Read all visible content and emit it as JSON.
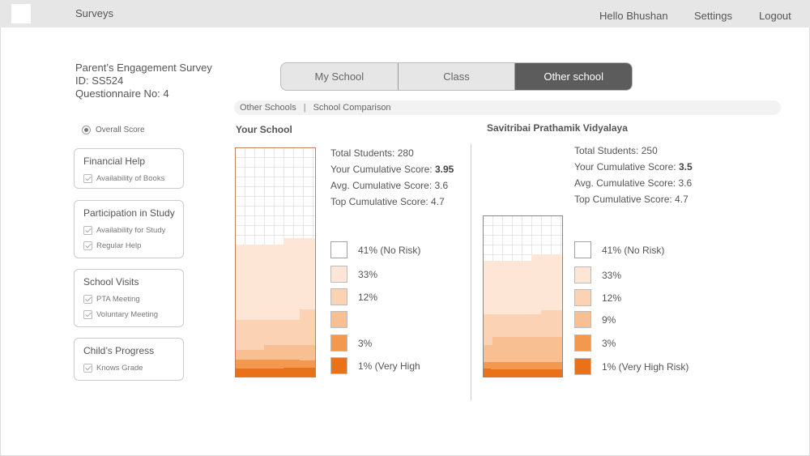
{
  "header": {
    "app_title": "Surveys",
    "greeting": "Hello Bhushan",
    "settings_label": "Settings",
    "logout_label": "Logout"
  },
  "survey": {
    "title": "Parent’s Engagement Survey",
    "id_text": "ID: SS524",
    "questionnaire_text": "Questionnaire No: 4"
  },
  "sidebar": {
    "overall_score_label": "Overall Score",
    "groups": [
      {
        "title": "Financial Help",
        "items": [
          "Availability of Books"
        ]
      },
      {
        "title": "Participation in Study",
        "items": [
          "Availability for Study",
          "Regular Help"
        ]
      },
      {
        "title": "School Visits",
        "items": [
          "PTA Meeting",
          "Voluntary Meeting"
        ]
      },
      {
        "title": "Child’s Progress",
        "items": [
          "Knows Grade"
        ]
      }
    ]
  },
  "tabs": [
    {
      "label": "My School"
    },
    {
      "label": "Class"
    },
    {
      "label": "Other school"
    }
  ],
  "breadcrumb": {
    "first": "Other Schools",
    "separator": "|",
    "second": "School Comparison"
  },
  "colors": {
    "no_risk": "#ffffff",
    "level_2": "#fde6d6",
    "level_3": "#fbd2b4",
    "level_4": "#f8bf93",
    "level_5": "#f2994f",
    "very_high_risk": "#e8711a"
  },
  "your_school": {
    "title": "Your School",
    "total_students": "Total Students: 280",
    "your_score_label": "Your Cumulative Score: ",
    "your_score_value": "3.95",
    "avg_score": "Avg. Cumulative Score: 3.6",
    "top_score": "Top Cumulative Score: 4.7",
    "legend": [
      "41% (No Risk)",
      "33%",
      "12%",
      "",
      "3%",
      "1% (Very High"
    ]
  },
  "other_school": {
    "title": "Savitribai Prathamik Vidyalaya",
    "total_students": "Total Students: 250",
    "your_score_label": "Your Cumulative Score: ",
    "your_score_value": "3.5",
    "avg_score": "Avg. Cumulative Score: 3.6",
    "top_score": "Top Cumulative Score: 4.7",
    "legend": [
      "41% (No Risk)",
      "33%",
      "12%",
      "9%",
      "3%",
      "1% (Very High Risk)"
    ]
  }
}
